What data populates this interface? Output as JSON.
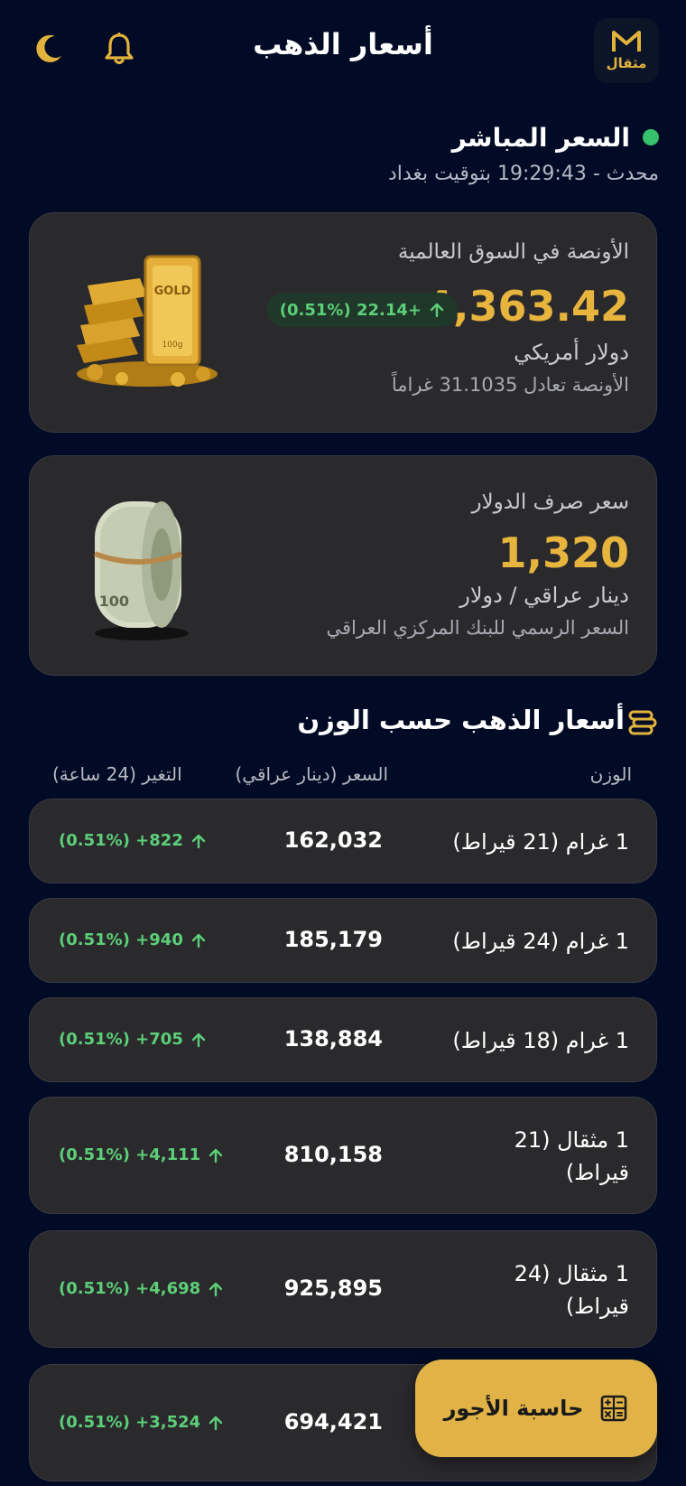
{
  "header": {
    "title": "أسعار الذهب",
    "logo_text": "مثقال",
    "bell_icon": "bell-icon",
    "moon_icon": "moon-icon"
  },
  "live": {
    "title": "السعر المباشر",
    "updated": "محدث - 19:29:43 بتوقيت بغداد",
    "dot_color": "#35c26a"
  },
  "ounce_card": {
    "label": "الأونصة في السوق العالمية",
    "price": "4,363.42",
    "change": "+22.14 (0.51%)",
    "currency": "دولار أمريكي",
    "note": "الأونصة تعادل 31.1035 غراماً"
  },
  "usd_card": {
    "label": "سعر صرف الدولار",
    "price": "1,320",
    "unit": "دينار عراقي / دولار",
    "note": "السعر الرسمي للبنك المركزي العراقي"
  },
  "weights": {
    "title": "أسعار الذهب حسب الوزن",
    "col_weight": "الوزن",
    "col_price": "السعر (دينار عراقي)",
    "col_change": "التغير (24 ساعة)",
    "rows": [
      {
        "weight": "1 غرام (21 قيراط)",
        "price": "162,032",
        "change": "822+ (0.51%)"
      },
      {
        "weight": "1 غرام (24 قيراط)",
        "price": "185,179",
        "change": "940+ (0.51%)"
      },
      {
        "weight": "1 غرام (18 قيراط)",
        "price": "138,884",
        "change": "705+ (0.51%)"
      },
      {
        "weight": "1 مثقال (21 قيراط)",
        "price": "810,158",
        "change": "4,111+ (0.51%)"
      },
      {
        "weight": "1 مثقال (24 قيراط)",
        "price": "925,895",
        "change": "4,698+ (0.51%)"
      },
      {
        "weight": "",
        "price": "694,421",
        "change": "3,524+ (0.51%)"
      }
    ]
  },
  "fab": {
    "label": "حاسبة الأجور",
    "icon": "calculator-icon"
  },
  "colors": {
    "background": "#020b25",
    "card": "#2a2a2d",
    "gold": "#e7b43e",
    "positive": "#5ccf78"
  }
}
